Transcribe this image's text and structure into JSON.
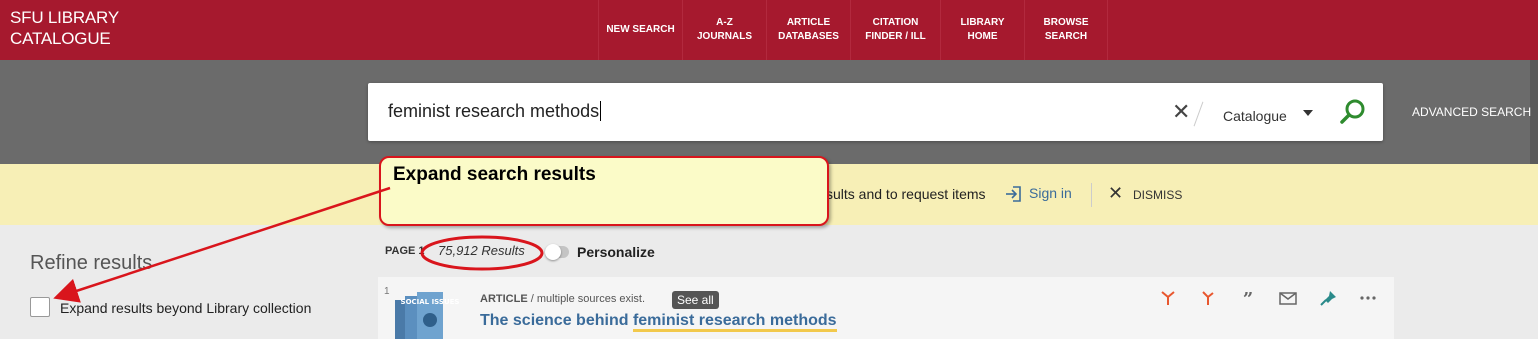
{
  "header": {
    "brand_line1": "SFU LIBRARY",
    "brand_line2": "CATALOGUE",
    "nav": [
      {
        "line1": "NEW SEARCH",
        "line2": ""
      },
      {
        "line1": "A-Z",
        "line2": "JOURNALS"
      },
      {
        "line1": "ARTICLE",
        "line2": "DATABASES"
      },
      {
        "line1": "CITATION",
        "line2": "FINDER / ILL"
      },
      {
        "line1": "LIBRARY",
        "line2": "HOME"
      },
      {
        "line1": "BROWSE",
        "line2": "SEARCH"
      }
    ]
  },
  "search": {
    "query": "feminist research methods",
    "scope": "Catalogue",
    "advanced_label": "ADVANCED SEARCH"
  },
  "notice": {
    "text": "sults and to request items",
    "signin_label": "Sign in",
    "dismiss_label": "DISMISS"
  },
  "annotation": {
    "callout_text": "Expand search results"
  },
  "refine": {
    "title": "Refine results",
    "expand_label": "Expand results beyond Library collection"
  },
  "results": {
    "page_label": "PAGE 1",
    "count_text": "75,912 Results",
    "personalize_label": "Personalize",
    "items": [
      {
        "number": "1",
        "type": "ARTICLE",
        "sources": " / multiple sources exist.",
        "see_all": "See all",
        "title_prefix": "The science behind ",
        "title_highlight": "feminist research methods",
        "thumb_text": "SOCIAL ISSUES"
      }
    ]
  },
  "colors": {
    "brand": "#a6192e",
    "notice_bg": "#f7efb6",
    "link": "#3a6b9a",
    "annotation_red": "#d9151c",
    "action_orange": "#e8572f"
  },
  "icons": {
    "search": "magnifier-icon",
    "clear": "close-icon",
    "signin": "sign-in-icon",
    "dismiss": "close-icon",
    "actions": [
      "share-icon",
      "cite-icon",
      "quote-icon",
      "email-icon",
      "pin-icon",
      "more-icon"
    ]
  }
}
